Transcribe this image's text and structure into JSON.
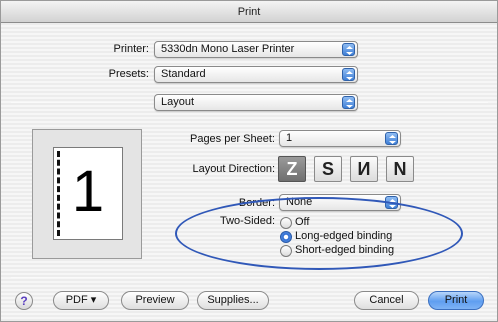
{
  "window": {
    "title": "Print"
  },
  "printer": {
    "label": "Printer:",
    "value": "5330dn Mono Laser Printer"
  },
  "presets": {
    "label": "Presets:",
    "value": "Standard"
  },
  "pane": {
    "value": "Layout"
  },
  "preview": {
    "page_number": "1"
  },
  "pages_per_sheet": {
    "label": "Pages per Sheet:",
    "value": "1"
  },
  "layout_direction": {
    "label": "Layout Direction:",
    "options": [
      {
        "glyph": "Z",
        "selected": true
      },
      {
        "glyph": "S",
        "selected": false
      },
      {
        "glyph": "И",
        "selected": false
      },
      {
        "glyph": "N",
        "selected": false
      }
    ]
  },
  "border": {
    "label": "Border:",
    "value": "None"
  },
  "two_sided": {
    "label": "Two-Sided:",
    "options": [
      {
        "label": "Off",
        "checked": false
      },
      {
        "label": "Long-edged binding",
        "checked": true
      },
      {
        "label": "Short-edged binding",
        "checked": false
      }
    ]
  },
  "footer": {
    "help": "?",
    "pdf": "PDF ▾",
    "preview": "Preview",
    "supplies": "Supplies...",
    "cancel": "Cancel",
    "print": "Print"
  },
  "colors": {
    "accent": "#3f7fd6",
    "highlight_ellipse": "#3058b8"
  }
}
